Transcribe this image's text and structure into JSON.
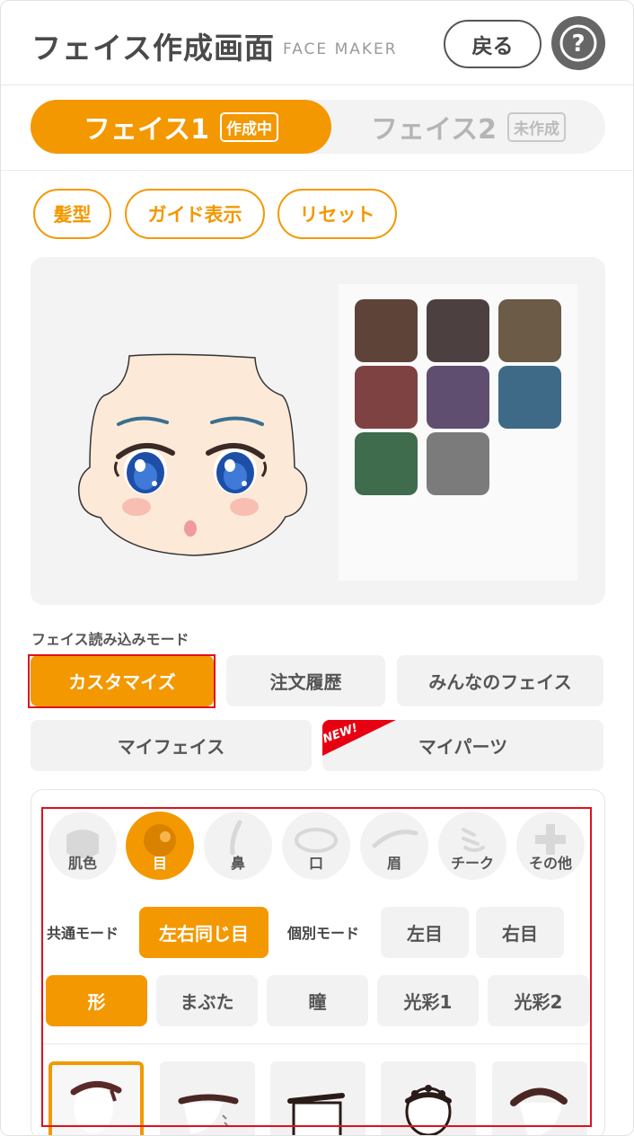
{
  "header": {
    "title": "フェイス作成画面",
    "subtitle": "FACE MAKER",
    "back_label": "戻る",
    "help_label": "?"
  },
  "face_tabs": [
    {
      "label": "フェイス1",
      "badge": "作成中",
      "active": true
    },
    {
      "label": "フェイス2",
      "badge": "未作成",
      "active": false
    }
  ],
  "tools": [
    {
      "label": "髪型"
    },
    {
      "label": "ガイド表示"
    },
    {
      "label": "リセット"
    }
  ],
  "palette": {
    "colors": [
      "#5e4338",
      "#4c4140",
      "#6b5b47",
      "#7f4243",
      "#5f4e70",
      "#3f6a87",
      "#3e6c4d",
      "#7b7b7b"
    ]
  },
  "load_mode": {
    "label": "フェイス読み込みモード",
    "buttons": [
      {
        "label": "カスタマイズ",
        "active": true
      },
      {
        "label": "注文履歴",
        "active": false
      },
      {
        "label": "みんなのフェイス",
        "active": false
      },
      {
        "label": "マイフェイス",
        "active": false
      },
      {
        "label": "マイパーツ",
        "active": false
      }
    ],
    "new_badge": "NEW!"
  },
  "categories": [
    {
      "label": "肌色",
      "icon": "skin-icon",
      "active": false
    },
    {
      "label": "目",
      "icon": "eye-icon",
      "active": true
    },
    {
      "label": "鼻",
      "icon": "nose-icon",
      "active": false
    },
    {
      "label": "口",
      "icon": "mouth-icon",
      "active": false
    },
    {
      "label": "眉",
      "icon": "eyebrow-icon",
      "active": false
    },
    {
      "label": "チーク",
      "icon": "cheek-icon",
      "active": false
    },
    {
      "label": "その他",
      "icon": "plus-icon",
      "active": false
    }
  ],
  "eye_mode": {
    "common_label": "共通モード",
    "same_label": "左右同じ目",
    "individual_label": "個別モード",
    "left_label": "左目",
    "right_label": "右目"
  },
  "sub_tabs": [
    {
      "label": "形",
      "active": true
    },
    {
      "label": "まぶた",
      "active": false
    },
    {
      "label": "瞳",
      "active": false
    },
    {
      "label": "光彩1",
      "active": false
    },
    {
      "label": "光彩2",
      "active": false
    }
  ],
  "colors": {
    "accent": "#f39800",
    "highlight_frame": "#e0101e"
  }
}
